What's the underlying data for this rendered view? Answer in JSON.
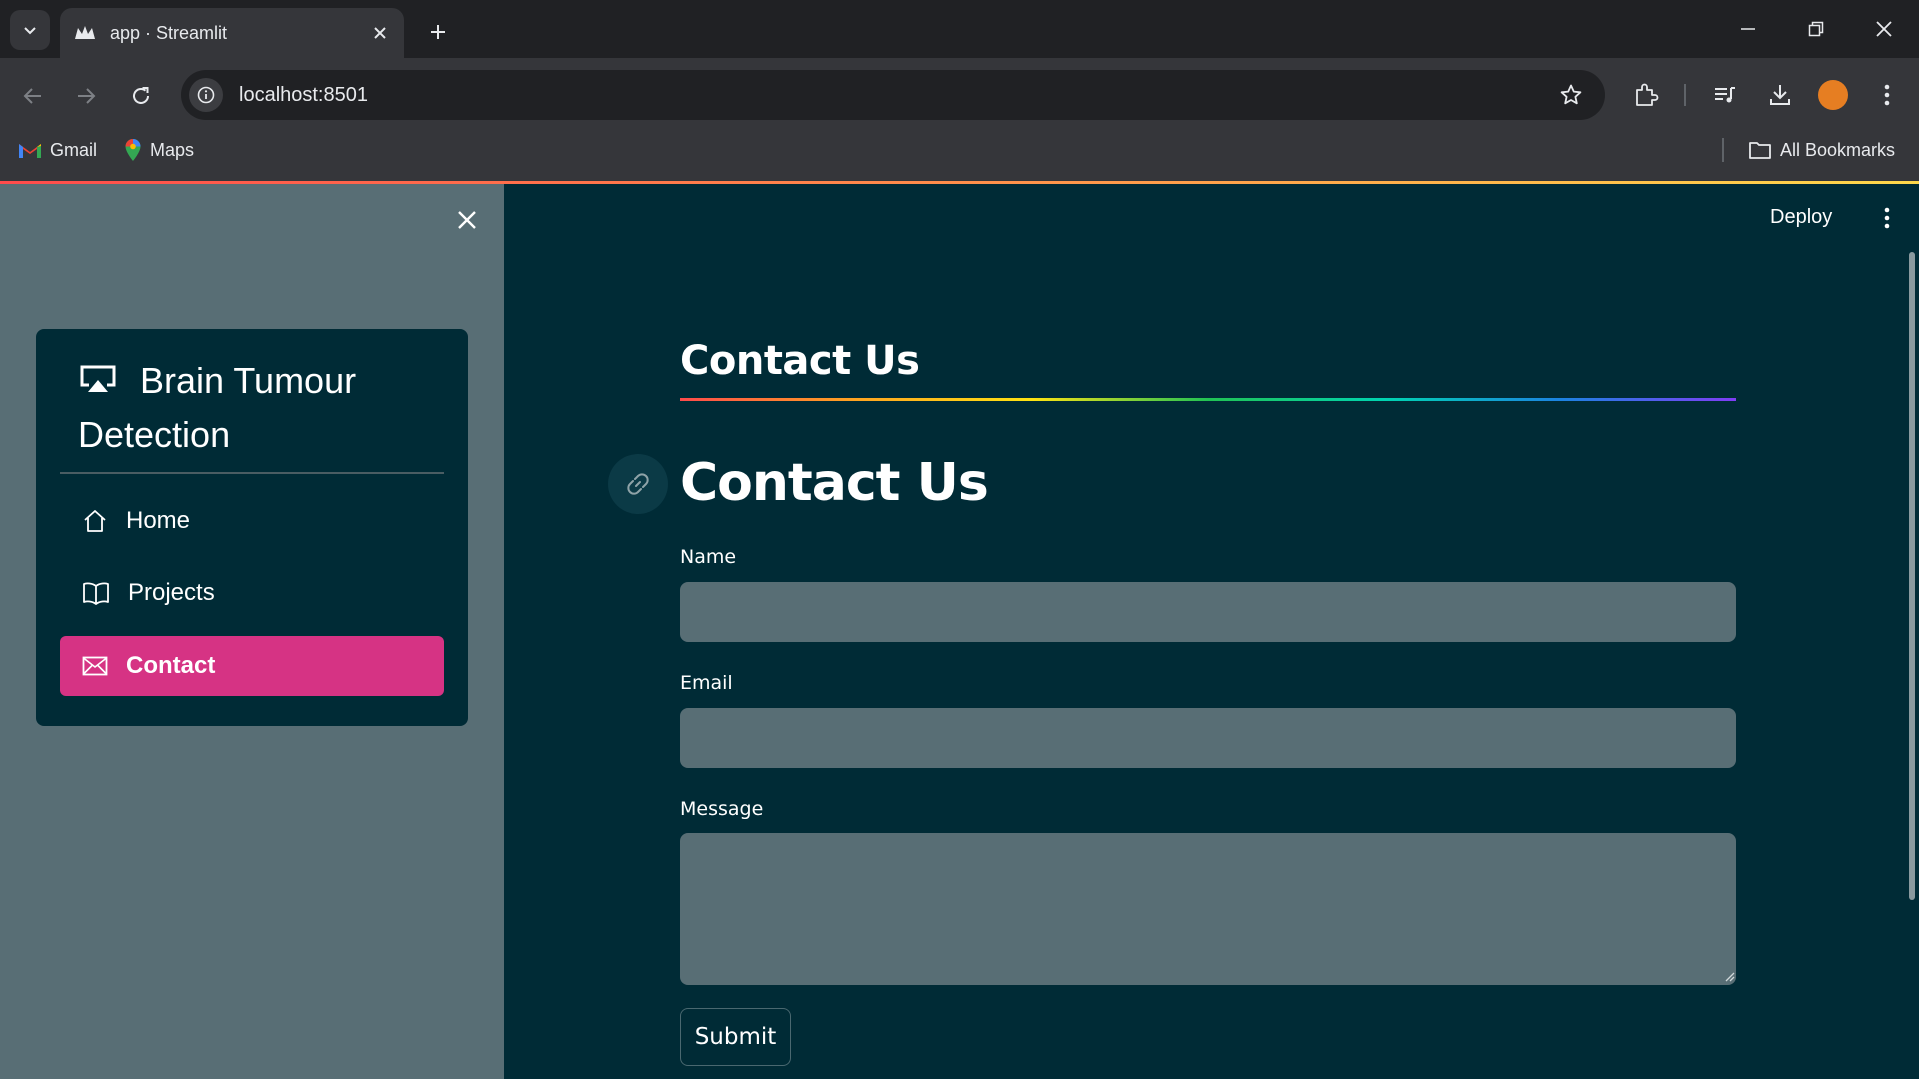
{
  "browser": {
    "tab_title": "app · Streamlit",
    "url": "localhost:8501",
    "bookmarks": [
      {
        "label": "Gmail",
        "icon": "gmail-icon"
      },
      {
        "label": "Maps",
        "icon": "maps-icon"
      }
    ],
    "all_bookmarks_label": "All Bookmarks",
    "profile_color": "#e67e22"
  },
  "app": {
    "deploy_label": "Deploy",
    "sidebar": {
      "menu_title": "Brain Tumour Detection",
      "menu_title_icon": "cast-icon",
      "items": [
        {
          "label": "Home",
          "icon": "house-icon",
          "active": false
        },
        {
          "label": "Projects",
          "icon": "book-icon",
          "active": false
        },
        {
          "label": "Contact",
          "icon": "envelope-icon",
          "active": true
        }
      ],
      "active_color": "#d63384"
    },
    "main": {
      "subheader": "Contact Us",
      "header": "Contact Us",
      "form": {
        "name_label": "Name",
        "name_value": "",
        "email_label": "Email",
        "email_value": "",
        "message_label": "Message",
        "message_value": "",
        "submit_label": "Submit"
      }
    },
    "colors": {
      "sidebar_bg": "#586e75",
      "main_bg": "#002b36",
      "input_bg": "#586e75"
    }
  }
}
